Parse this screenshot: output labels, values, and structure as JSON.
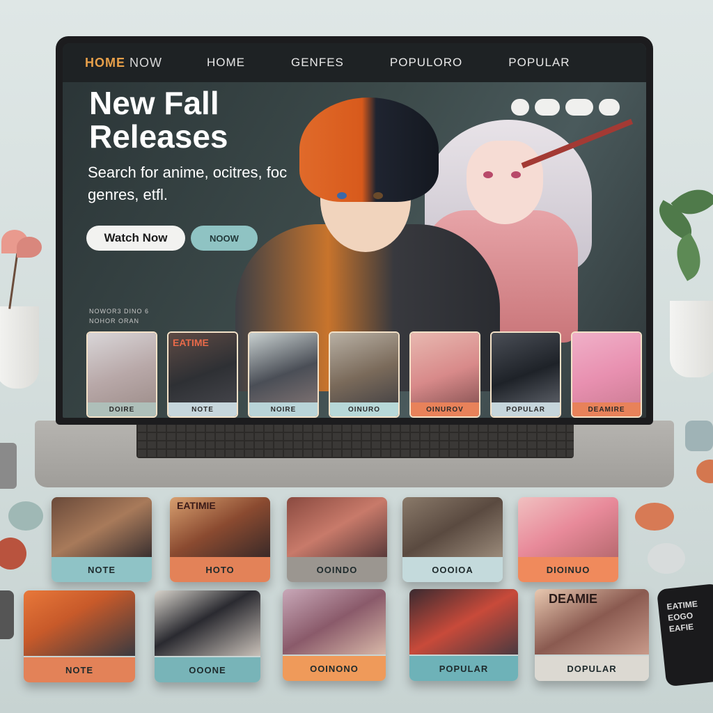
{
  "nav": {
    "brand": "HOME",
    "brand_suffix": "NOW",
    "links": [
      "HOME",
      "GENFES",
      "POPULORO",
      "POPULAR"
    ]
  },
  "hero": {
    "title": "New Fall Releases",
    "subtitle": "Search for anime, ocitres, foc genres, etfl.",
    "watch_button": "Watch Now",
    "secondary_button": "NOOW",
    "pills": [
      "",
      "",
      "",
      ""
    ]
  },
  "section": {
    "label": "NOWOR3 DINO 6",
    "label_2": "NOHOR ORAN"
  },
  "screen_cards": [
    {
      "caption": "DOIRE",
      "cap_color": "#aebfb9"
    },
    {
      "caption": "NOTE",
      "cap_color": "#c6d6dc"
    },
    {
      "caption": "NOIRE",
      "cap_color": "#b9d4d8"
    },
    {
      "caption": "OINURO",
      "cap_color": "#b7d8d8"
    },
    {
      "caption": "OINUROV",
      "cap_color": "#e8825a"
    },
    {
      "caption": "POPULAR",
      "cap_color": "#c6d6dc"
    },
    {
      "caption": "DEAMIRE",
      "cap_color": "#e8825a"
    }
  ],
  "screen_card_title": "EATIME",
  "desk_cards": [
    {
      "caption": "NOTE",
      "cap_color": "#8fc3c6"
    },
    {
      "caption": "HOTO",
      "cap_color": "#e38258"
    },
    {
      "caption": "OOINDO",
      "cap_color": "#9b9690"
    },
    {
      "caption": "OOOIOA",
      "cap_color": "#c4dadc"
    },
    {
      "caption": "DIOINUO",
      "cap_color": "#f08a5c"
    },
    {
      "caption": "NOTE",
      "cap_color": "#e38258"
    },
    {
      "caption": "OOONE",
      "cap_color": "#78b4b8"
    },
    {
      "caption": "OOINONO",
      "cap_color": "#ef9a5a"
    },
    {
      "caption": "POPULAR",
      "cap_color": "#6eb2b8"
    },
    {
      "caption": "DOPULAR",
      "cap_color": "#dcd9d2"
    }
  ],
  "desk_card_titles": {
    "top_second": "EATIMIE",
    "bottom_fifth": "DEAMIE"
  },
  "phone_text": "EATIME\nEOGO\nEAFIE"
}
